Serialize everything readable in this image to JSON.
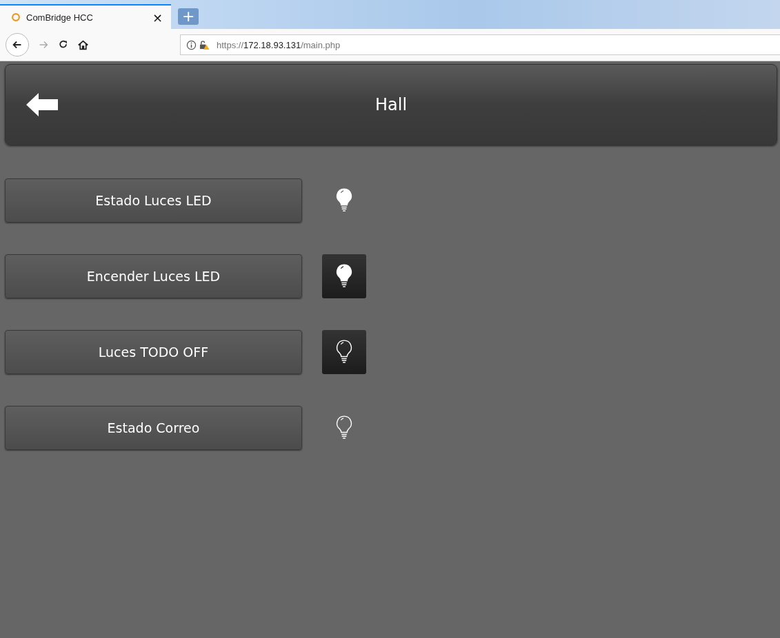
{
  "browser": {
    "tab": {
      "title": "ComBridge HCC",
      "close": "×",
      "selected": true
    },
    "new_tab": "+",
    "url": {
      "scheme": "https://",
      "host": "172.18.93.131",
      "path": "/main.php"
    }
  },
  "header": {
    "title": "Hall"
  },
  "rows": [
    {
      "label": "Estado Luces LED",
      "kind": "indicator",
      "on": true
    },
    {
      "label": "Encender Luces LED",
      "kind": "button",
      "on": true
    },
    {
      "label": "Luces TODO OFF",
      "kind": "button",
      "on": false
    },
    {
      "label": "Estado Correo",
      "kind": "indicator",
      "on": false
    }
  ]
}
